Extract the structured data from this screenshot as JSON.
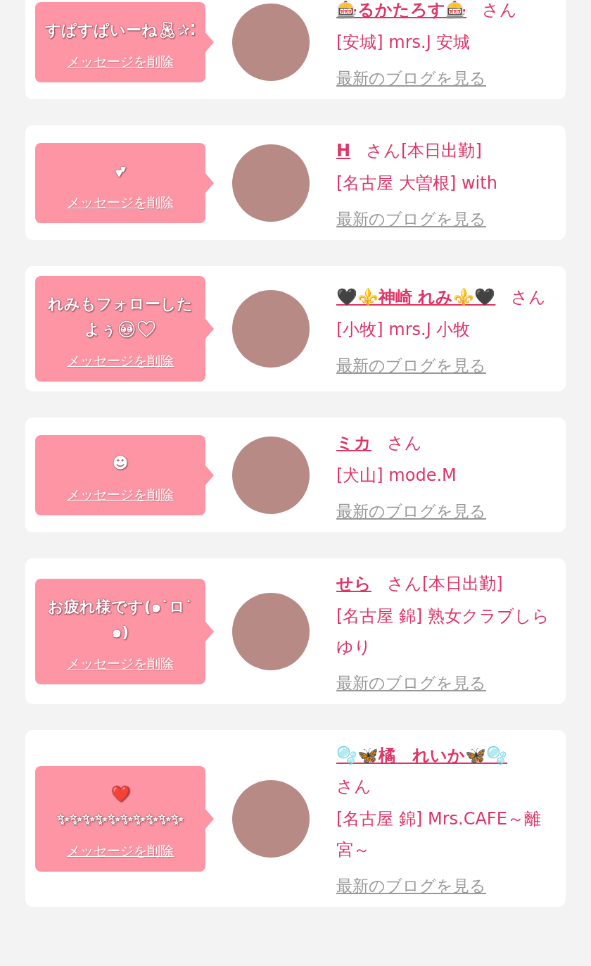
{
  "messages": [
    {
      "message": "すぱすぱいーね🧸✰⁚",
      "delete_link": "メッセージを削除",
      "name": "🎰るかたろす🎰",
      "honorific": "さん",
      "shop": "[安城] mrs.J 安城",
      "blog_link": "最新のブログを見る"
    },
    {
      "message": "💕",
      "delete_link": "メッセージを削除",
      "name": "H",
      "honorific": "さん",
      "tag": "[本日出勤]",
      "shop": "[名古屋 大曽根] with",
      "blog_link": "最新のブログを見る"
    },
    {
      "message": "れみもフォローしたよぅ🥹🤍",
      "delete_link": "メッセージを削除",
      "name": "🖤⚜️神崎 れみ⚜️🖤",
      "honorific": "さん",
      "shop": "[小牧] mrs.J 小牧",
      "blog_link": "最新のブログを見る"
    },
    {
      "message": "☻",
      "delete_link": "メッセージを削除",
      "name": "ミカ",
      "honorific": "さん",
      "shop": "[犬山] mode.M",
      "blog_link": "最新のブログを見る"
    },
    {
      "message": "お疲れ様です(๑˙ロ˙๑)",
      "delete_link": "メッセージを削除",
      "name": "せら",
      "honorific": "さん",
      "tag": "[本日出勤]",
      "shop": "[名古屋 錦] 熟女クラブしらゆり",
      "blog_link": "最新のブログを見る"
    },
    {
      "message": "❤️\n✨✨✨✨✨✨✨✨✨✨",
      "delete_link": "メッセージを削除",
      "name": "🫧🦋橘　れいか🦋🫧",
      "honorific": "さん",
      "shop": "[名古屋 錦] Mrs.CAFE～離宮～",
      "blog_link": "最新のブログを見る"
    }
  ]
}
